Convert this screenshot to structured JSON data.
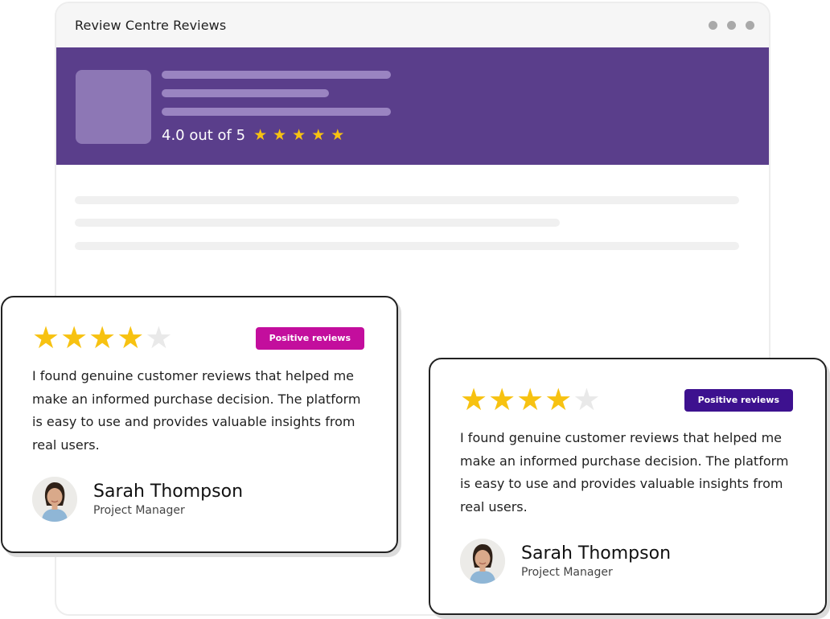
{
  "window": {
    "title": "Review Centre Reviews"
  },
  "summary": {
    "rating_text": "4.0 out of 5",
    "stars_shown": 5,
    "star_glyph": "★"
  },
  "reviews": [
    {
      "rating": 4,
      "max_rating": 5,
      "badge": "Positive reviews",
      "text": "I found genuine customer reviews that helped me make an informed purchase decision. The platform is easy to use and provides valuable insights from real users.",
      "name": "Sarah Thompson",
      "role": "Project Manager"
    },
    {
      "rating": 4,
      "max_rating": 5,
      "badge": "Positive reviews",
      "text": "I found genuine customer reviews that helped me make an informed purchase decision. The platform is easy to use and provides valuable insights from real users.",
      "name": "Sarah Thompson",
      "role": "Project Manager"
    }
  ],
  "colors": {
    "hero": "#5a3e8b",
    "star": "#f7c211",
    "badge_1": "#c30e9d",
    "badge_2": "#3d118f"
  },
  "icons": {
    "window_controls": "more-dots-icon",
    "star": "star-icon",
    "avatar": "avatar-person-icon"
  }
}
